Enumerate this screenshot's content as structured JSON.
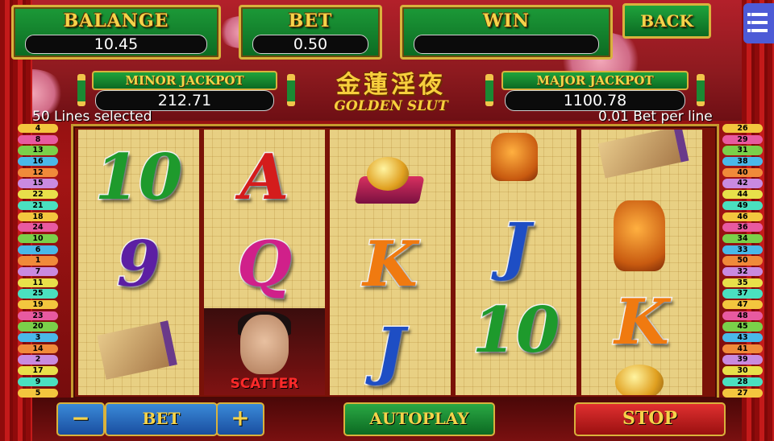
{
  "header": {
    "balance_label": "BALANGE",
    "balance_value": "10.45",
    "bet_label": "BET",
    "bet_value": "0.50",
    "win_label": "WIN",
    "win_value": "",
    "back_label": "BACK",
    "menu_icon": "menu-list-icon"
  },
  "jackpots": {
    "minor_label": "MINOR JACKPOT",
    "minor_value": "212.71",
    "major_label": "MAJOR JACKPOT",
    "major_value": "1100.78"
  },
  "logo": {
    "chinese": "金蓮淫夜",
    "english": "GOLDEN SLUT"
  },
  "info": {
    "lines_selected": "50 Lines selected",
    "bet_per_line": "0.01 Bet per line"
  },
  "line_numbers": {
    "left": [
      "4",
      "8",
      "13",
      "16",
      "12",
      "15",
      "22",
      "21",
      "18",
      "24",
      "10",
      "6",
      "1",
      "7",
      "11",
      "25",
      "19",
      "23",
      "20",
      "3",
      "14",
      "2",
      "17",
      "9",
      "5"
    ],
    "right": [
      "26",
      "29",
      "31",
      "38",
      "40",
      "42",
      "44",
      "49",
      "46",
      "36",
      "34",
      "33",
      "50",
      "32",
      "35",
      "37",
      "47",
      "48",
      "45",
      "43",
      "41",
      "39",
      "30",
      "28",
      "27"
    ]
  },
  "reels": [
    {
      "symbols": [
        "10",
        "9",
        "scroll"
      ]
    },
    {
      "symbols": [
        "A",
        "Q",
        "scatter"
      ]
    },
    {
      "symbols": [
        "ingot-cushion",
        "K",
        "J"
      ]
    },
    {
      "symbols": [
        "cat-statue",
        "J",
        "10"
      ]
    },
    {
      "symbols": [
        "scroll",
        "cat-statue",
        "K"
      ]
    }
  ],
  "scatter_label": "SCATTER",
  "controls": {
    "minus_label": "−",
    "bet_label": "BET",
    "plus_label": "+",
    "autoplay_label": "AUTOPLAY",
    "stop_label": "STOP"
  },
  "colors": {
    "panel_green": "#0c6a22",
    "gold_text": "#f5d34a",
    "gold_border": "#d9b23c",
    "stop_red": "#d41c1c",
    "bet_blue": "#1a4ea0"
  }
}
